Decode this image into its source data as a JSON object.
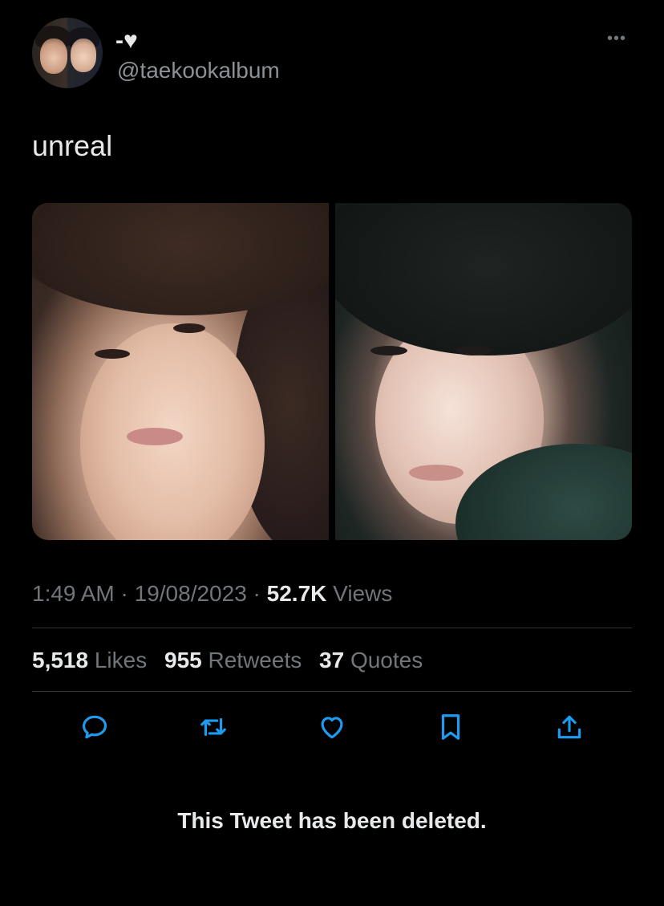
{
  "tweet": {
    "display_name": "-♥",
    "handle": "@taekookalbum",
    "more_label": "•••",
    "text": "unreal",
    "time": "1:49 AM",
    "date": "19/08/2023",
    "views_count": "52.7K",
    "views_label": "Views",
    "separator": " · "
  },
  "stats": {
    "likes_count": "5,518",
    "likes_label": "Likes",
    "retweets_count": "955",
    "retweets_label": "Retweets",
    "quotes_count": "37",
    "quotes_label": "Quotes"
  },
  "actions": {
    "icons": [
      "reply-icon",
      "retweet-icon",
      "like-icon",
      "bookmark-icon",
      "share-icon"
    ],
    "icon_color": "#1d9bf0"
  },
  "notice": {
    "deleted_text": "This Tweet has been deleted."
  },
  "colors": {
    "background": "#000000",
    "primary_text": "#e7e9ea",
    "secondary_text": "#71767b",
    "divider": "#2f3336",
    "accent": "#1d9bf0"
  }
}
